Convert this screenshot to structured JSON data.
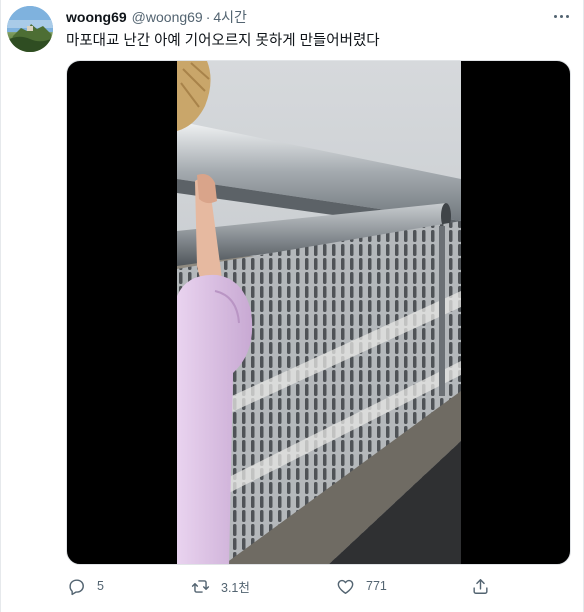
{
  "post": {
    "display_name": "woong69",
    "handle": "@woong69",
    "separator": "·",
    "timestamp": "4시간",
    "text": "마포대교 난간 아예 기어오르지 못하게 만들어버렸다",
    "media": {
      "type": "video"
    },
    "actions": {
      "reply_count": "5",
      "retweet_count": "3.1천",
      "like_count": "771"
    }
  },
  "icons": {
    "more": "more-horizontal-icon",
    "reply": "reply-bubble-icon",
    "retweet": "retweet-icon",
    "like": "heart-icon",
    "share": "share-upload-icon"
  },
  "colors": {
    "text_primary": "#0f1419",
    "text_secondary": "#536471",
    "media_background": "#000000"
  }
}
